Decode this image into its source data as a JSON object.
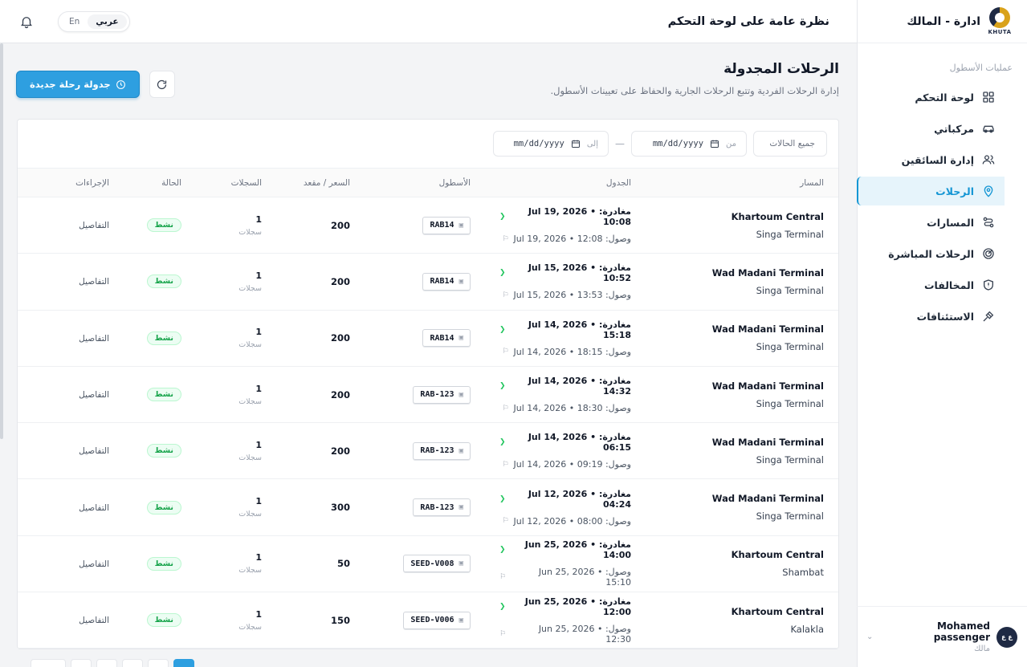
{
  "sidebar": {
    "brand_title": "ادارة - المالك",
    "logo_word": "KHUTA",
    "section_label": "عمليات الأسطول",
    "items": [
      {
        "label": "لوحة التحكم",
        "icon": "grid-icon"
      },
      {
        "label": "مركباتي",
        "icon": "car-icon"
      },
      {
        "label": "إدارة السائقين",
        "icon": "users-icon"
      },
      {
        "label": "الرحلات",
        "icon": "map-pin-icon",
        "active": true
      },
      {
        "label": "المسارات",
        "icon": "route-icon"
      },
      {
        "label": "الرحلات المباشرة",
        "icon": "radar-icon"
      },
      {
        "label": "المخالفات",
        "icon": "shield-alert-icon"
      },
      {
        "label": "الاستئنافات",
        "icon": "gavel-icon"
      }
    ],
    "profile": {
      "name": "Mohamed passenger",
      "role": "مالك",
      "avatar_text": "ع ع"
    }
  },
  "header": {
    "title": "نظرة عامة على لوحة التحكم",
    "lang_ar": "عربي",
    "lang_en": "En"
  },
  "page": {
    "title": "الرحلات المجدولة",
    "subtitle": "إدارة الرحلات الفردية وتتبع الرحلات الجارية والحفاظ على تعيينات الأسطول.",
    "new_trip_label": "جدولة رحلة جديدة"
  },
  "filters": {
    "status_label": "جميع الحالات",
    "from_label": "من",
    "to_label": "إلى",
    "from_value": "mm/dd/yyyy",
    "to_value": "mm/dd/yyyy",
    "separator": "—"
  },
  "table": {
    "columns": {
      "route": "المسار",
      "schedule": "الجدول",
      "fleet": "الأسطول",
      "price": "السعر / مقعد",
      "records": "السجلات",
      "status": "الحالة",
      "actions": "الإجراءات"
    },
    "rows": [
      {
        "from": "Khartoum Central",
        "to": "Singa Terminal",
        "dep": "مغادرة: Jul 19, 2026 • 10:08",
        "arr": "وصول: Jul 19, 2026 • 12:08",
        "fleet": "RAB14",
        "price": "200",
        "records": "1",
        "records_unit": "سجلات",
        "status": "نشط",
        "action": "التفاصيل"
      },
      {
        "from": "Wad Madani Terminal",
        "to": "Singa Terminal",
        "dep": "مغادرة: Jul 15, 2026 • 10:52",
        "arr": "وصول: Jul 15, 2026 • 13:53",
        "fleet": "RAB14",
        "price": "200",
        "records": "1",
        "records_unit": "سجلات",
        "status": "نشط",
        "action": "التفاصيل"
      },
      {
        "from": "Wad Madani Terminal",
        "to": "Singa Terminal",
        "dep": "مغادرة: Jul 14, 2026 • 15:18",
        "arr": "وصول: Jul 14, 2026 • 18:15",
        "fleet": "RAB14",
        "price": "200",
        "records": "1",
        "records_unit": "سجلات",
        "status": "نشط",
        "action": "التفاصيل"
      },
      {
        "from": "Wad Madani Terminal",
        "to": "Singa Terminal",
        "dep": "مغادرة: Jul 14, 2026 • 14:32",
        "arr": "وصول: Jul 14, 2026 • 18:30",
        "fleet": "RAB-123",
        "price": "200",
        "records": "1",
        "records_unit": "سجلات",
        "status": "نشط",
        "action": "التفاصيل"
      },
      {
        "from": "Wad Madani Terminal",
        "to": "Singa Terminal",
        "dep": "مغادرة: Jul 14, 2026 • 06:15",
        "arr": "وصول: Jul 14, 2026 • 09:19",
        "fleet": "RAB-123",
        "price": "200",
        "records": "1",
        "records_unit": "سجلات",
        "status": "نشط",
        "action": "التفاصيل"
      },
      {
        "from": "Wad Madani Terminal",
        "to": "Singa Terminal",
        "dep": "مغادرة: Jul 12, 2026 • 04:24",
        "arr": "وصول: Jul 12, 2026 • 08:00",
        "fleet": "RAB-123",
        "price": "300",
        "records": "1",
        "records_unit": "سجلات",
        "status": "نشط",
        "action": "التفاصيل"
      },
      {
        "from": "Khartoum Central",
        "to": "Shambat",
        "dep": "مغادرة: Jun 25, 2026 • 14:00",
        "arr": "وصول: Jun 25, 2026 • 15:10",
        "fleet": "SEED-V008",
        "price": "50",
        "records": "1",
        "records_unit": "سجلات",
        "status": "نشط",
        "action": "التفاصيل"
      },
      {
        "from": "Khartoum Central",
        "to": "Kalakla",
        "dep": "مغادرة: Jun 25, 2026 • 12:00",
        "arr": "وصول: Jun 25, 2026 • 12:30",
        "fleet": "SEED-V006",
        "price": "150",
        "records": "1",
        "records_unit": "سجلات",
        "status": "نشط",
        "action": "التفاصيل"
      }
    ]
  },
  "colors": {
    "accent": "#2e9fe0",
    "active_nav_bg": "#e6f4fb",
    "status_green": "#16a34a"
  }
}
